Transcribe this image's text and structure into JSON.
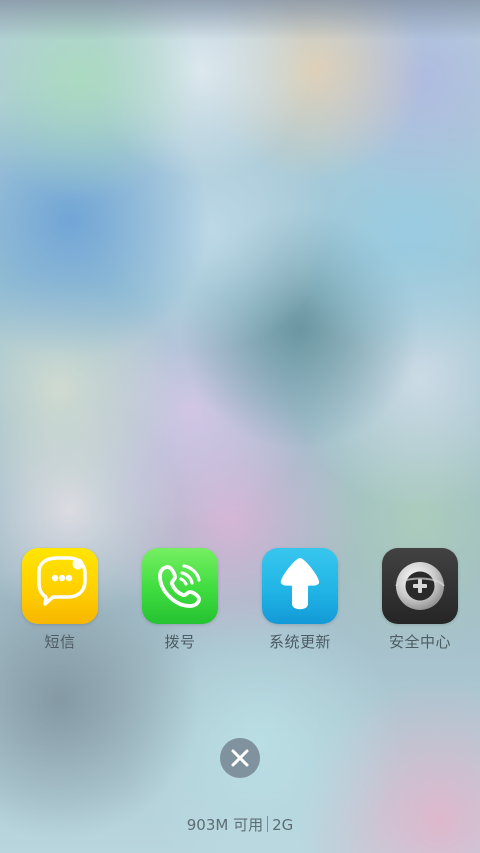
{
  "dock": {
    "apps": [
      {
        "label": "短信",
        "icon": "message-bubble-icon",
        "color": "#FFD600"
      },
      {
        "label": "拨号",
        "icon": "phone-call-icon",
        "color": "#3FDC3F"
      },
      {
        "label": "系统更新",
        "icon": "upload-arrow-icon",
        "color": "#1FB3E8"
      },
      {
        "label": "安全中心",
        "icon": "shield-ring-icon",
        "color": "#2F2F2F"
      }
    ]
  },
  "close_button": {
    "icon": "close-icon"
  },
  "memory_status": {
    "available": "903M 可用",
    "network": "2G"
  }
}
